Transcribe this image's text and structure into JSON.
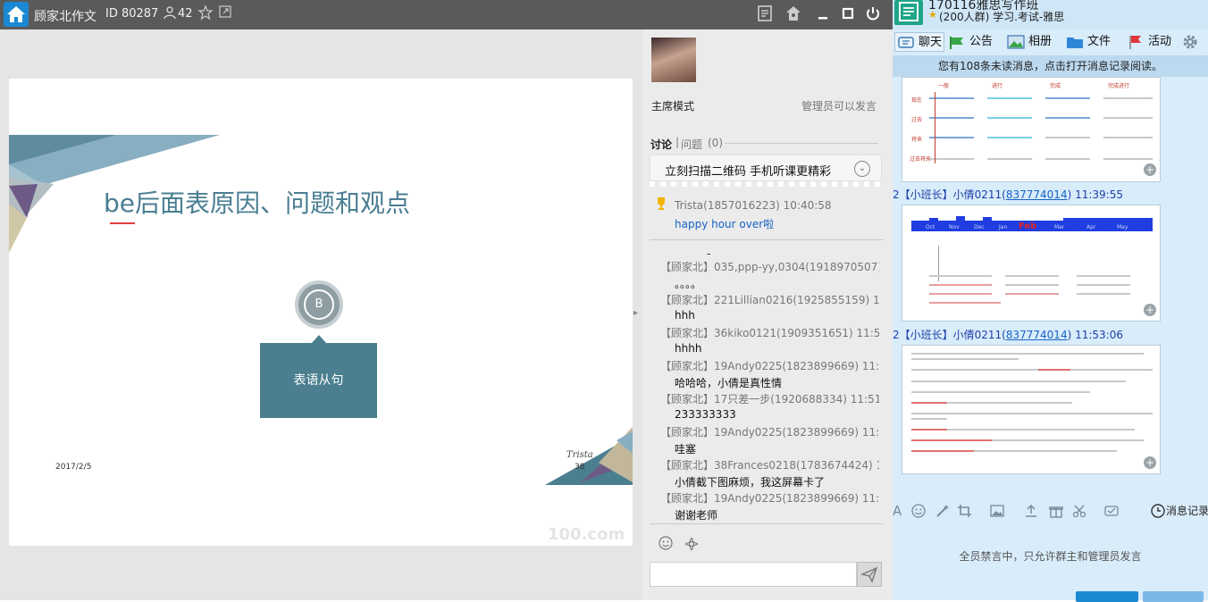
{
  "classroom": {
    "title": "顾家北作文",
    "id_label": "ID 80287",
    "viewer_count": "42"
  },
  "slide": {
    "title": "be后面表原因、问题和观点",
    "circle_letter": "B",
    "box_text": "表语从句",
    "date": "2017/2/5",
    "page_number": "38",
    "signature": "Trista",
    "watermark": "100.com"
  },
  "sidepanel": {
    "mode": "主席模式",
    "permission": "管理员可以发言",
    "tab_discussion": "讨论",
    "tab_questions": "问题",
    "questions_count": "(0)",
    "banner_text": "立刻扫描二维码 手机听课更精彩",
    "pinned_meta": "Trista(1857016223) 10:40:58",
    "pinned_body": "happy hour over啦",
    "dash": "-",
    "messages": [
      {
        "meta": "【顾家北】035,ppp-yy,0304(1918970507)",
        "body": "。。。。"
      },
      {
        "meta": "【顾家北】221Lillian0216(1925855159) 11",
        "body": "hhh"
      },
      {
        "meta": "【顾家北】36kiko0121(1909351651) 11:51",
        "body": "hhhh"
      },
      {
        "meta": "【顾家北】19Andy0225(1823899669) 11:5",
        "body": "哈哈哈，小倩是真性情"
      },
      {
        "meta": "【顾家北】17只差一步(1920688334) 11:51:",
        "body": "233333333"
      },
      {
        "meta": "【顾家北】19Andy0225(1823899669) 11:5",
        "body": "哇塞"
      },
      {
        "meta": "【顾家北】38Frances0218(1783674424) 1",
        "body": "小倩截下图麻烦，我这屏幕卡了"
      },
      {
        "meta": "【顾家北】19Andy0225(1823899669) 11:5",
        "body": "谢谢老师"
      }
    ]
  },
  "qq": {
    "group_name": "170116雅思写作班",
    "group_sub": "(200人群) 学习.考试-雅思",
    "tabs": [
      "聊天",
      "公告",
      "相册",
      "文件",
      "活动"
    ],
    "notice": "您有108条未读消息，点击打开消息记录阅读。",
    "messages": [
      {
        "prefix": "2【小班长】小倩0211(",
        "qq": "837774014",
        "suffix": ")  11:39:55"
      },
      {
        "prefix": "2【小班长】小倩0211(",
        "qq": "837774014",
        "suffix": ")  11:53:06"
      }
    ],
    "img1_labels": [
      "一般",
      "进行",
      "完成",
      "完成进行",
      "现在",
      "过去",
      "将来",
      "过去将来"
    ],
    "img2_months": [
      "Oct",
      "Nov",
      "Dec",
      "Jan",
      "Feb",
      "Mar",
      "Apr",
      "May"
    ],
    "history": "消息记录",
    "muted": "全员禁言中，只允许群主和管理员发言"
  },
  "colors": {
    "slide_teal": "#4b7f90",
    "title_teal": "#4a7e92",
    "qq_blue": "#1e3fa8",
    "accent_red": "#e04040"
  }
}
